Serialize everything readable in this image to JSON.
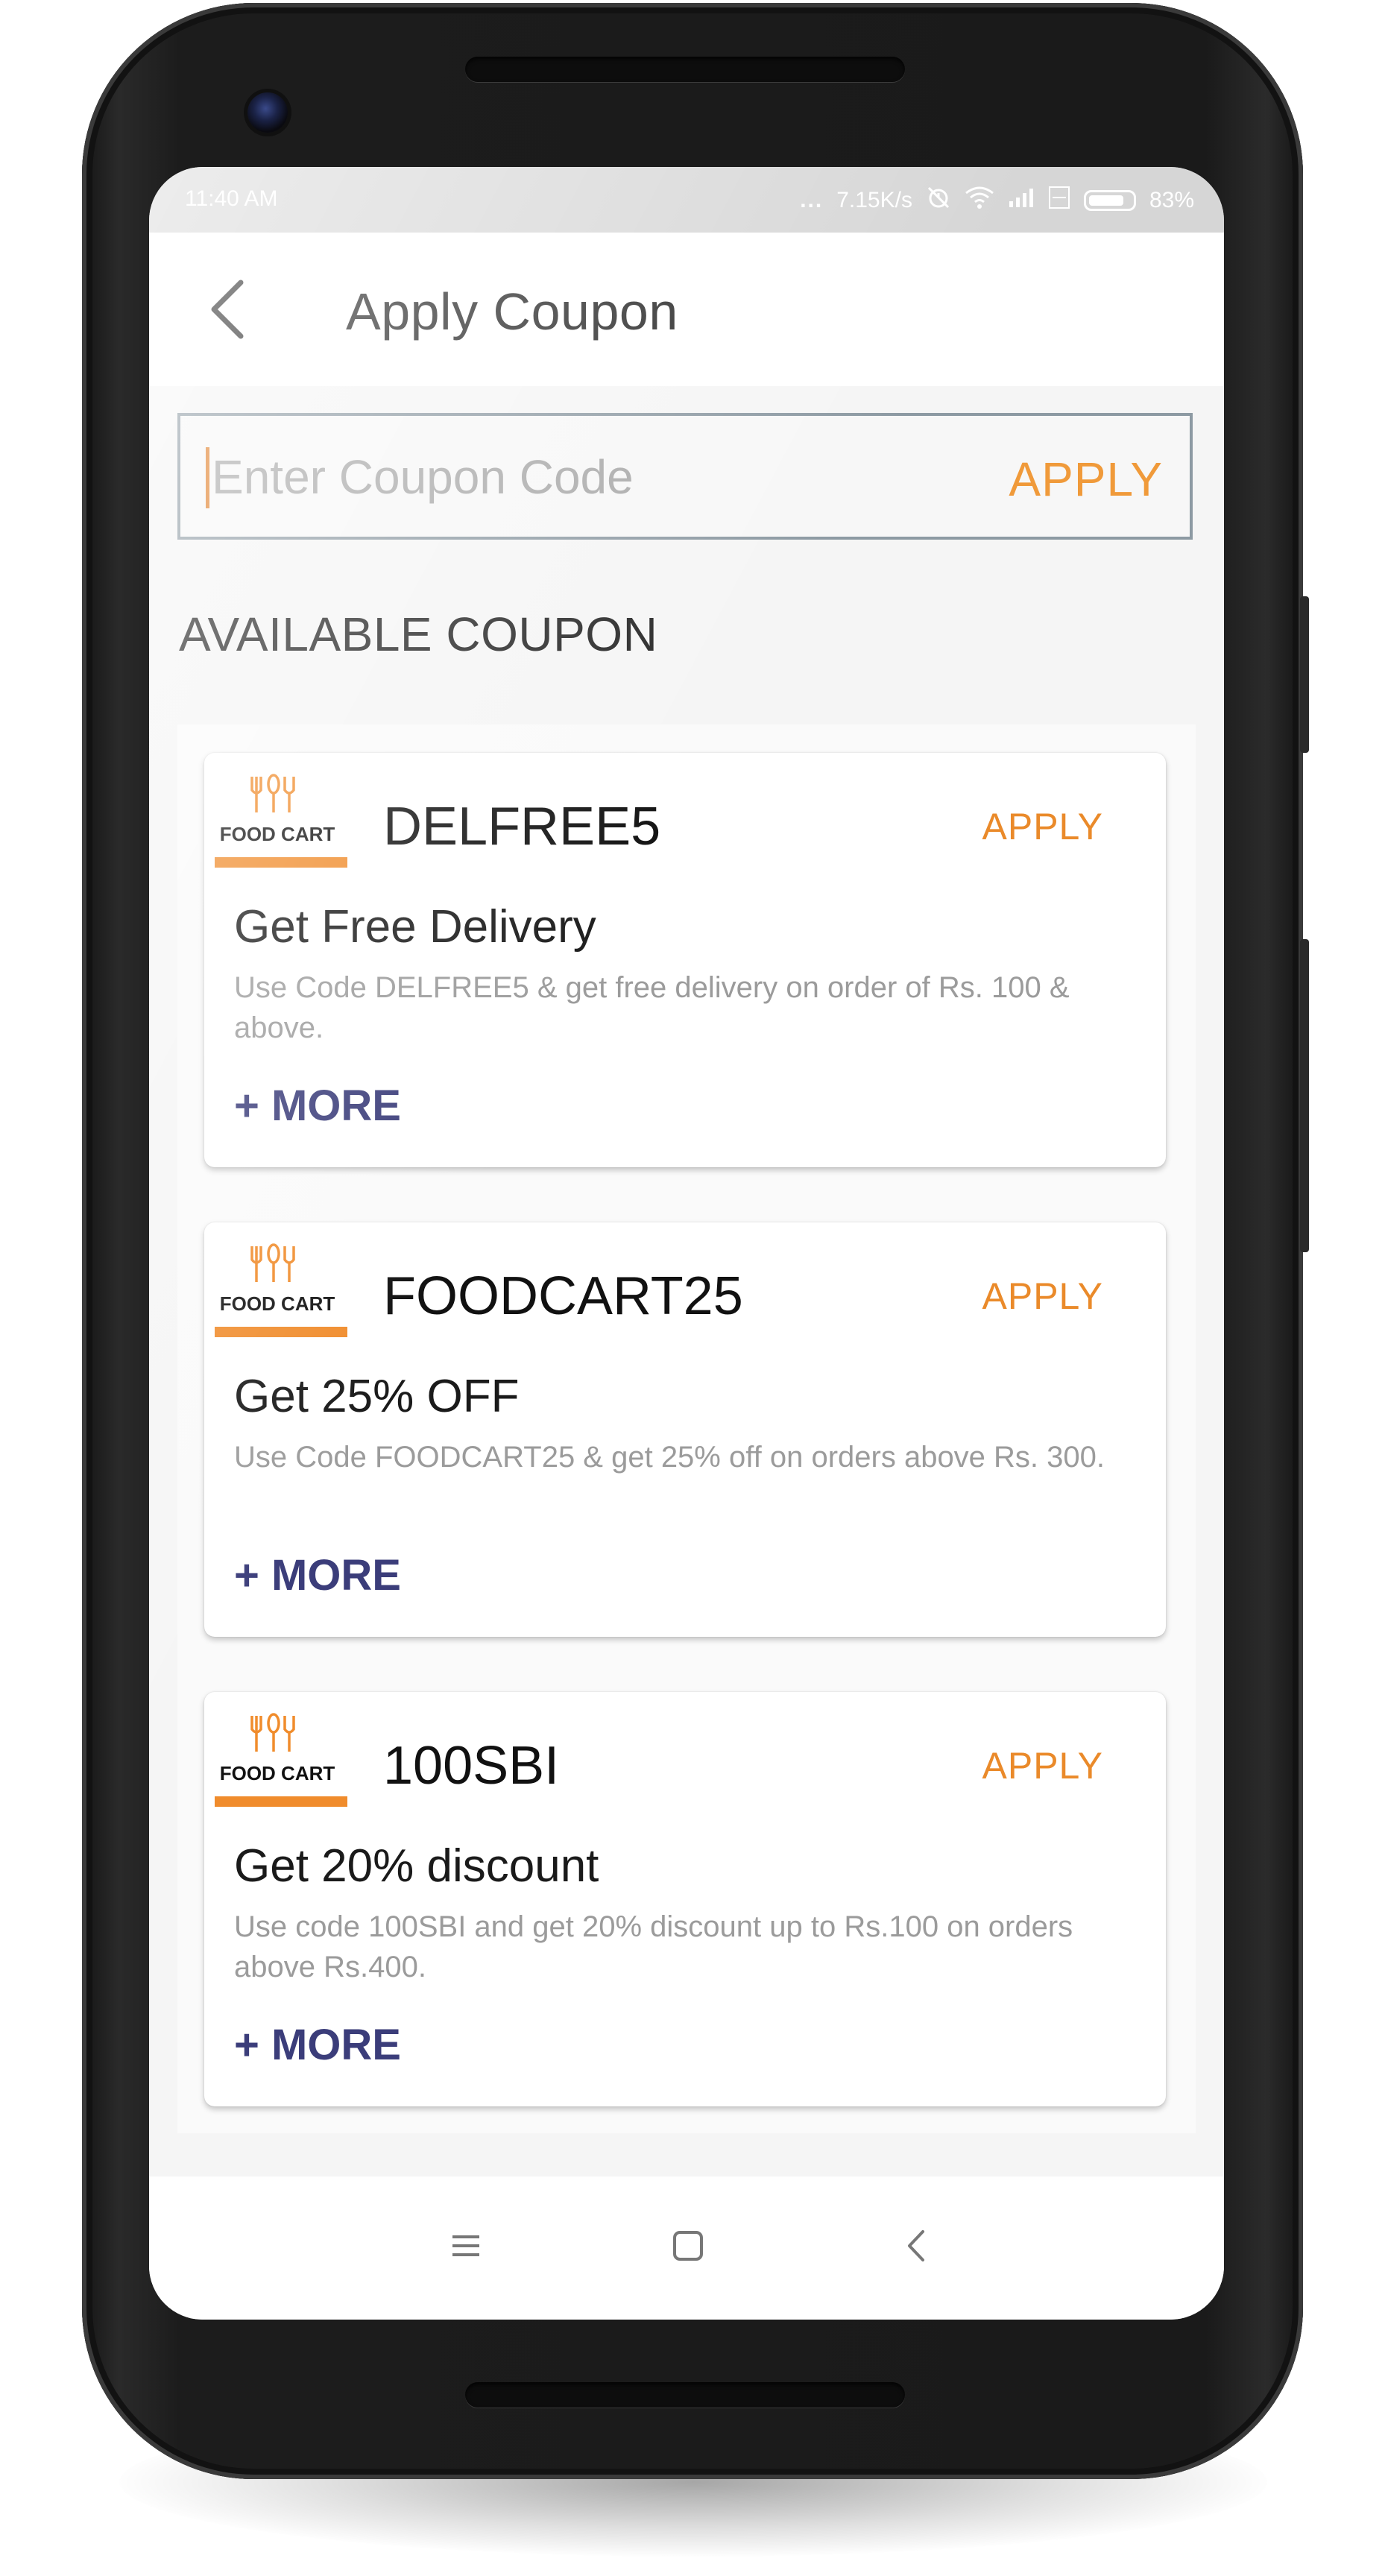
{
  "status_bar": {
    "time": "11:40 AM",
    "dots": "...",
    "network_speed": "7.15K/s",
    "battery_percent": "83%"
  },
  "toolbar": {
    "title": "Apply Coupon"
  },
  "coupon_input": {
    "placeholder": "Enter Coupon Code",
    "value": "",
    "apply_label": "APPLY"
  },
  "section_title": "AVAILABLE COUPON",
  "coupons": [
    {
      "logo_text": "FOOD CART",
      "code": "DELFREE5",
      "apply_label": "APPLY",
      "title": "Get Free Delivery",
      "description": "Use Code DELFREE5 & get free delivery on order of Rs. 100 & above.",
      "more_label": "+ MORE"
    },
    {
      "logo_text": "FOOD CART",
      "code": "FOODCART25",
      "apply_label": "APPLY",
      "title": "Get 25% OFF",
      "description": "Use Code FOODCART25 & get 25% off on orders above Rs. 300.",
      "more_label": "+ MORE"
    },
    {
      "logo_text": "FOOD CART",
      "code": "100SBI",
      "apply_label": "APPLY",
      "title": "Get 20% discount",
      "description": "Use code 100SBI and get 20% discount up to Rs.100 on orders above Rs.400.",
      "more_label": "+ MORE"
    }
  ],
  "nav_bar": {
    "menu_icon": "menu-icon",
    "home_icon": "square-home-icon",
    "back_icon": "back-triangle-icon"
  },
  "colors": {
    "accent_orange": "#ea8a2a",
    "more_blue": "#3b3d7a",
    "input_border": "#8d9aa3"
  }
}
